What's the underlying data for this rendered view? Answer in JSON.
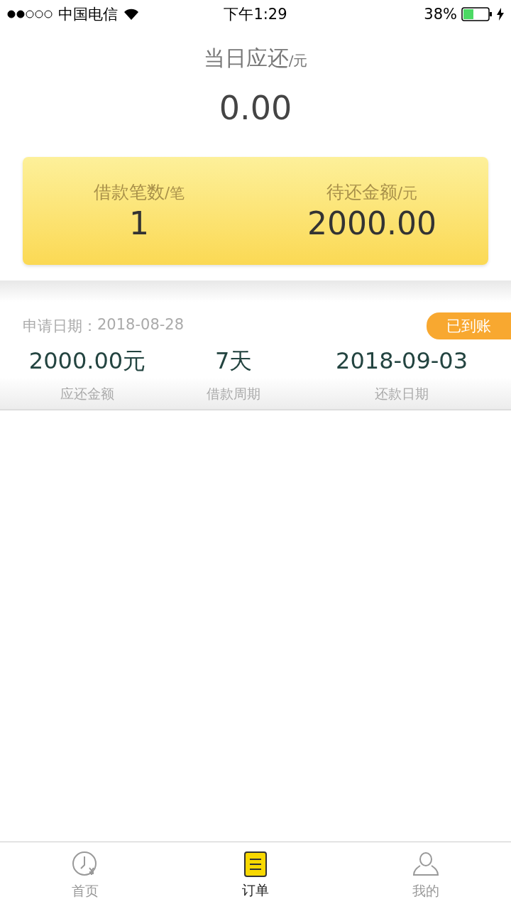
{
  "status_bar": {
    "carrier": "中国电信",
    "time": "下午1:29",
    "battery": "38%"
  },
  "due_today": {
    "label": "当日应还",
    "unit": "/元",
    "amount": "0.00"
  },
  "summary": [
    {
      "label": "借款笔数",
      "unit": "/笔",
      "value": "1"
    },
    {
      "label": "待还金额",
      "unit": "/元",
      "value": "2000.00"
    }
  ],
  "loans": [
    {
      "apply_label": "申请日期：",
      "apply_date": "2018-08-28",
      "badge": "已到账",
      "stats": [
        {
          "value": "2000.00元",
          "label": "应还金额"
        },
        {
          "value": "7天",
          "label": "借款周期"
        },
        {
          "value": "2018-09-03",
          "label": "还款日期"
        }
      ]
    }
  ],
  "tabs": [
    {
      "label": "首页",
      "kind": "home",
      "selected": false
    },
    {
      "label": "订单",
      "kind": "orders",
      "selected": true
    },
    {
      "label": "我的",
      "kind": "profile",
      "selected": false
    }
  ]
}
